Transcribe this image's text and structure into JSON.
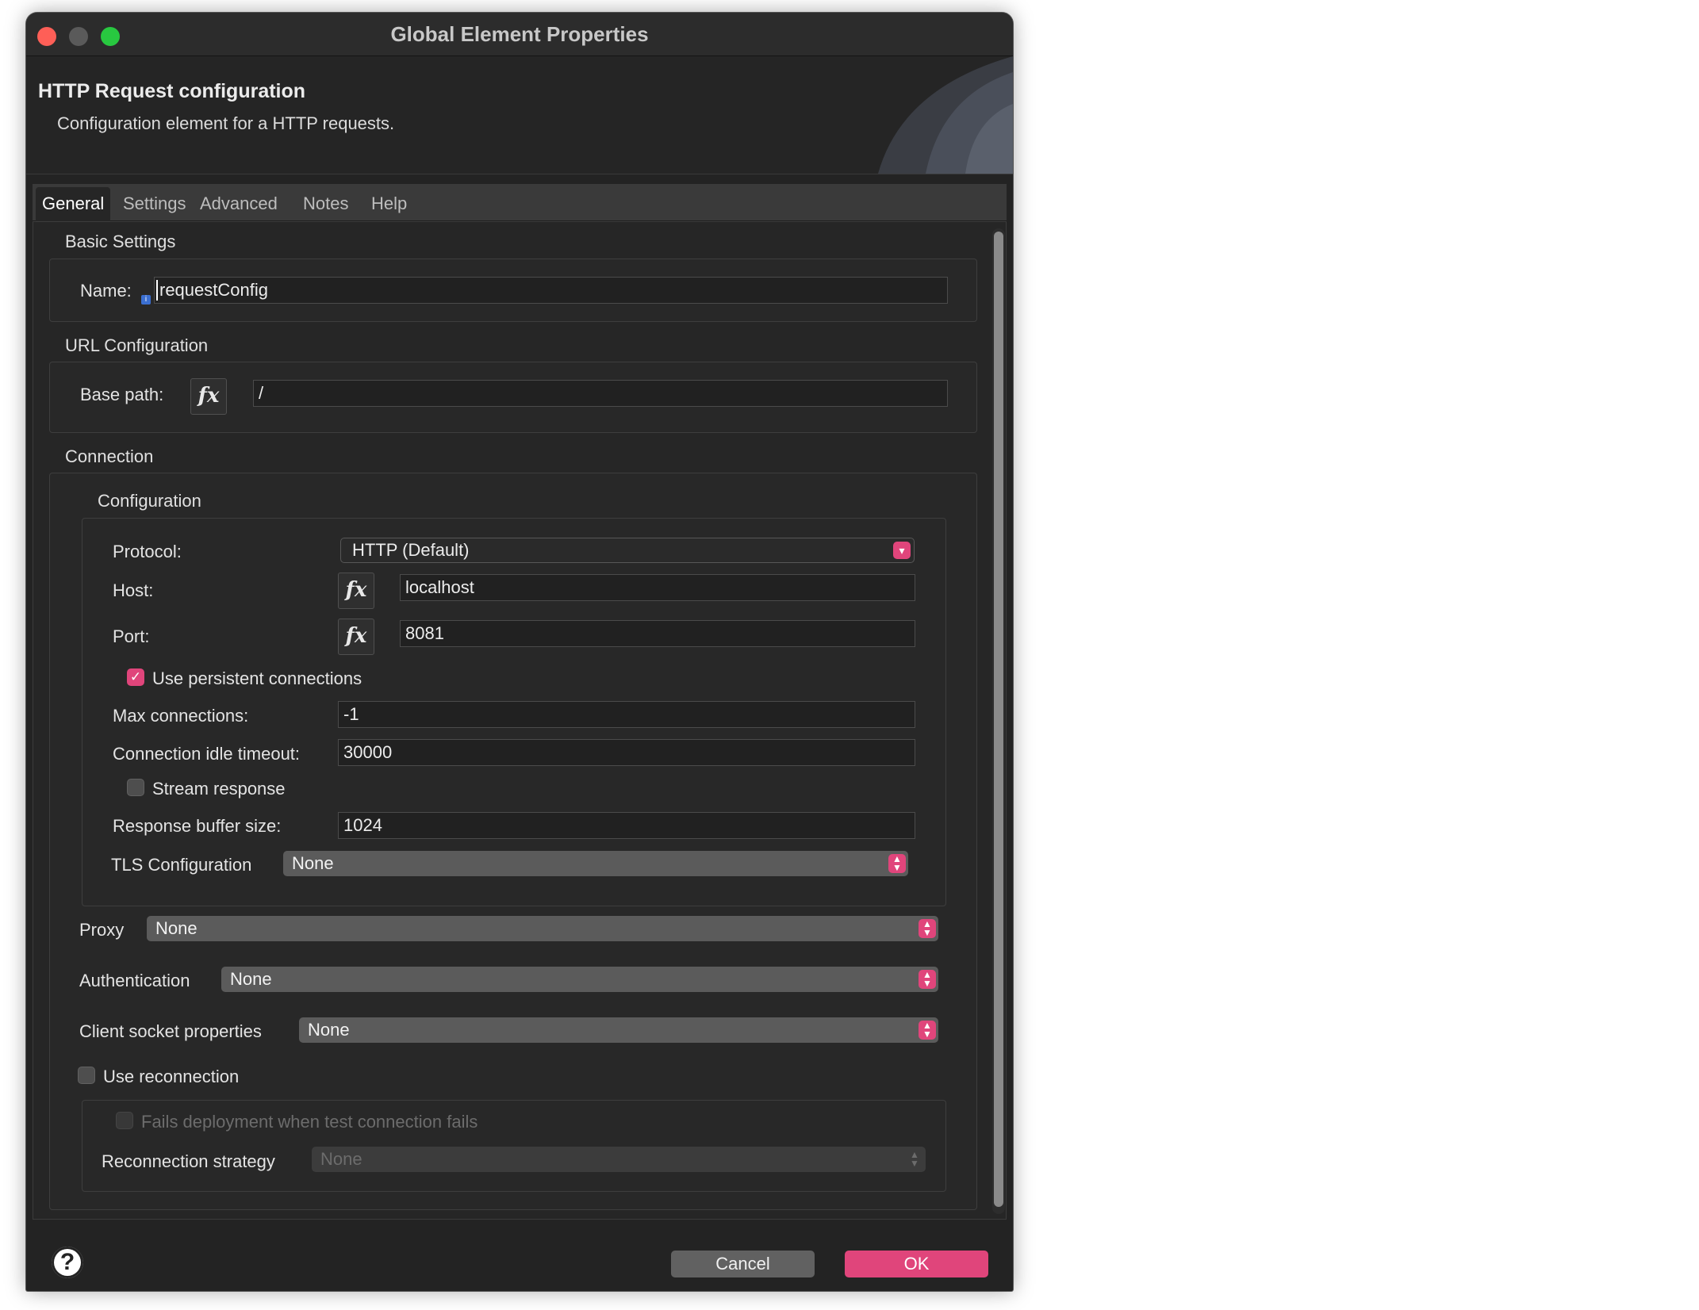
{
  "window": {
    "title": "Global Element Properties"
  },
  "header": {
    "title": "HTTP Request configuration",
    "description": "Configuration element for a HTTP requests."
  },
  "tabs": [
    {
      "label": "General",
      "active": true
    },
    {
      "label": "Settings",
      "active": false
    },
    {
      "label": "Advanced",
      "active": false
    },
    {
      "label": "Notes",
      "active": false
    },
    {
      "label": "Help",
      "active": false
    }
  ],
  "basic_settings": {
    "section_label": "Basic Settings",
    "name_label": "Name:",
    "name_value": "requestConfig"
  },
  "url_configuration": {
    "section_label": "URL Configuration",
    "base_path_label": "Base path:",
    "base_path_value": "/"
  },
  "connection": {
    "section_label": "Connection",
    "configuration_label": "Configuration",
    "protocol_label": "Protocol:",
    "protocol_value": "HTTP (Default)",
    "host_label": "Host:",
    "host_value": "localhost",
    "port_label": "Port:",
    "port_value": "8081",
    "persistent_label": "Use persistent connections",
    "persistent_checked": true,
    "max_connections_label": "Max connections:",
    "max_connections_value": "-1",
    "idle_timeout_label": "Connection idle timeout:",
    "idle_timeout_value": "30000",
    "stream_response_label": "Stream response",
    "stream_response_checked": false,
    "buffer_size_label": "Response buffer size:",
    "buffer_size_value": "1024",
    "tls_label": "TLS Configuration",
    "tls_value": "None",
    "proxy_label": "Proxy",
    "proxy_value": "None",
    "auth_label": "Authentication",
    "auth_value": "None",
    "socket_label": "Client socket properties",
    "socket_value": "None",
    "reconnection_label": "Use reconnection",
    "reconnection_checked": false,
    "fails_deployment_label": "Fails deployment when test connection fails",
    "reconnection_strategy_label": "Reconnection strategy",
    "reconnection_strategy_value": "None"
  },
  "icons": {
    "fx": "fx",
    "help": "?"
  },
  "footer": {
    "cancel_label": "Cancel",
    "ok_label": "OK"
  },
  "colors": {
    "accent": "#e0457b",
    "window_bg": "#232323"
  }
}
